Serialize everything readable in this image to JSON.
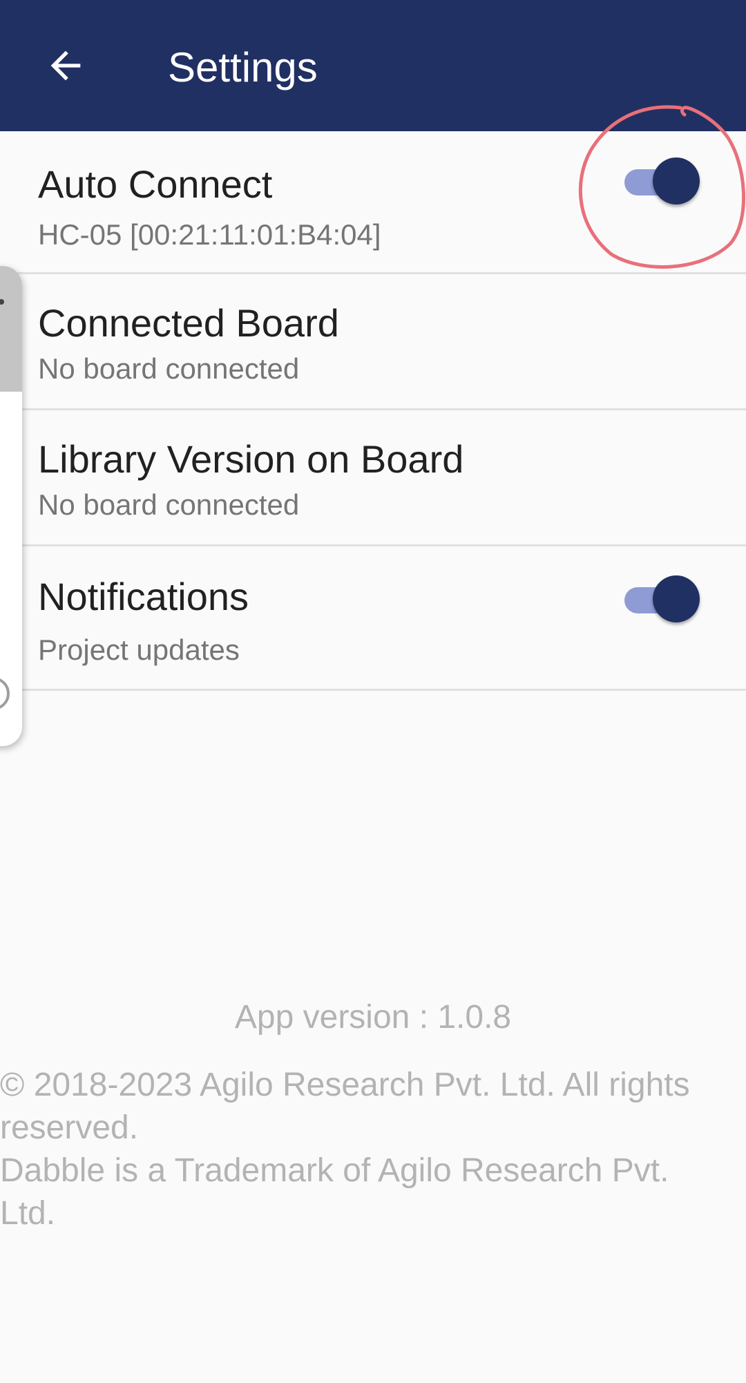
{
  "header": {
    "back_icon": "arrow-left-icon",
    "title": "Settings",
    "background_color": "#213063"
  },
  "settings": [
    {
      "title": "Auto Connect",
      "subtitle": "HC-05 [00:21:11:01:B4:04]",
      "toggle_on": true
    },
    {
      "title": "Connected Board",
      "subtitle": "No board connected"
    },
    {
      "title": "Library Version on Board",
      "subtitle": "No board connected"
    },
    {
      "title": "Notifications",
      "subtitle": "Project updates",
      "toggle_on": true
    }
  ],
  "footer": {
    "app_version": "App version : 1.0.8",
    "copyright": "© 2018-2023 Agilo Research Pvt. Ltd. All rights reserved.\nDabble is a Trademark of Agilo Research Pvt. Ltd."
  },
  "colors": {
    "accent": "#213063",
    "switch_track": "#8f9bd5",
    "annotation": "#e8707a"
  }
}
